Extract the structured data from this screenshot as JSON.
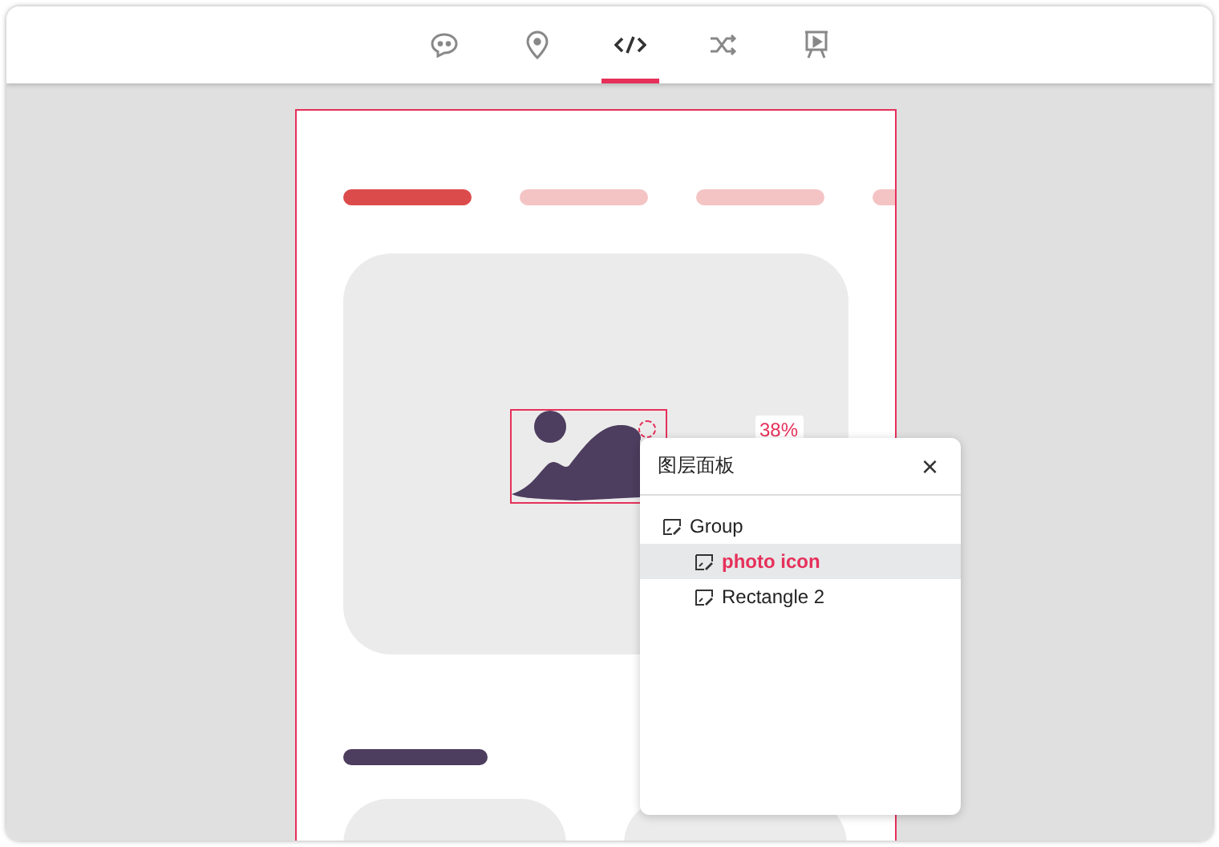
{
  "toolbar": {
    "tabs": [
      {
        "kind": "chat",
        "selected": false
      },
      {
        "kind": "pin",
        "selected": false
      },
      {
        "kind": "code",
        "selected": true
      },
      {
        "kind": "shuffle",
        "selected": false
      },
      {
        "kind": "present",
        "selected": false
      }
    ]
  },
  "artboard": {
    "steps": [
      {
        "selected": true
      },
      {
        "selected": false
      },
      {
        "selected": false
      },
      {
        "selected": false
      }
    ],
    "rotation_reading": "38%"
  },
  "layers_panel": {
    "title": "图层面板",
    "close": "×",
    "layers": [
      {
        "name": "Group",
        "selected": false,
        "children": [
          {
            "name": "photo icon",
            "selected": true
          },
          {
            "name": "Rectangle 2",
            "selected": false
          }
        ]
      }
    ]
  }
}
